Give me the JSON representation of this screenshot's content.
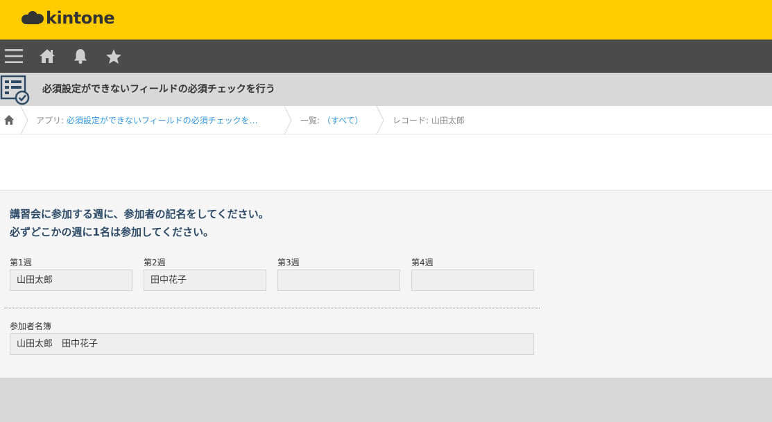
{
  "header": {
    "logo_text": "kintone",
    "brand_color": "#ffcc00"
  },
  "nav": {
    "icons": [
      "menu-icon",
      "home-icon",
      "bell-icon",
      "star-icon"
    ]
  },
  "app": {
    "title": "必須設定ができないフィールドの必須チェックを行う",
    "icon": "app-form-check-icon"
  },
  "breadcrumb": {
    "home_icon": "home-icon",
    "app_prefix": "アプリ:",
    "app_link": "必須設定ができないフィールドの必須チェックを…",
    "list_prefix": "一覧:",
    "list_link": "（すべて）",
    "record": "レコード: 山田太郎"
  },
  "form": {
    "instruction_line1": "講習会に参加する週に、参加者の記名をしてください。",
    "instruction_line2": "必ずどこかの週に1名は参加してください。",
    "weeks": [
      {
        "label": "第1週",
        "value": "山田太郎"
      },
      {
        "label": "第2週",
        "value": "田中花子"
      },
      {
        "label": "第3週",
        "value": ""
      },
      {
        "label": "第4週",
        "value": ""
      }
    ],
    "roster": {
      "label": "参加者名簿",
      "value": "山田太郎　田中花子"
    }
  }
}
